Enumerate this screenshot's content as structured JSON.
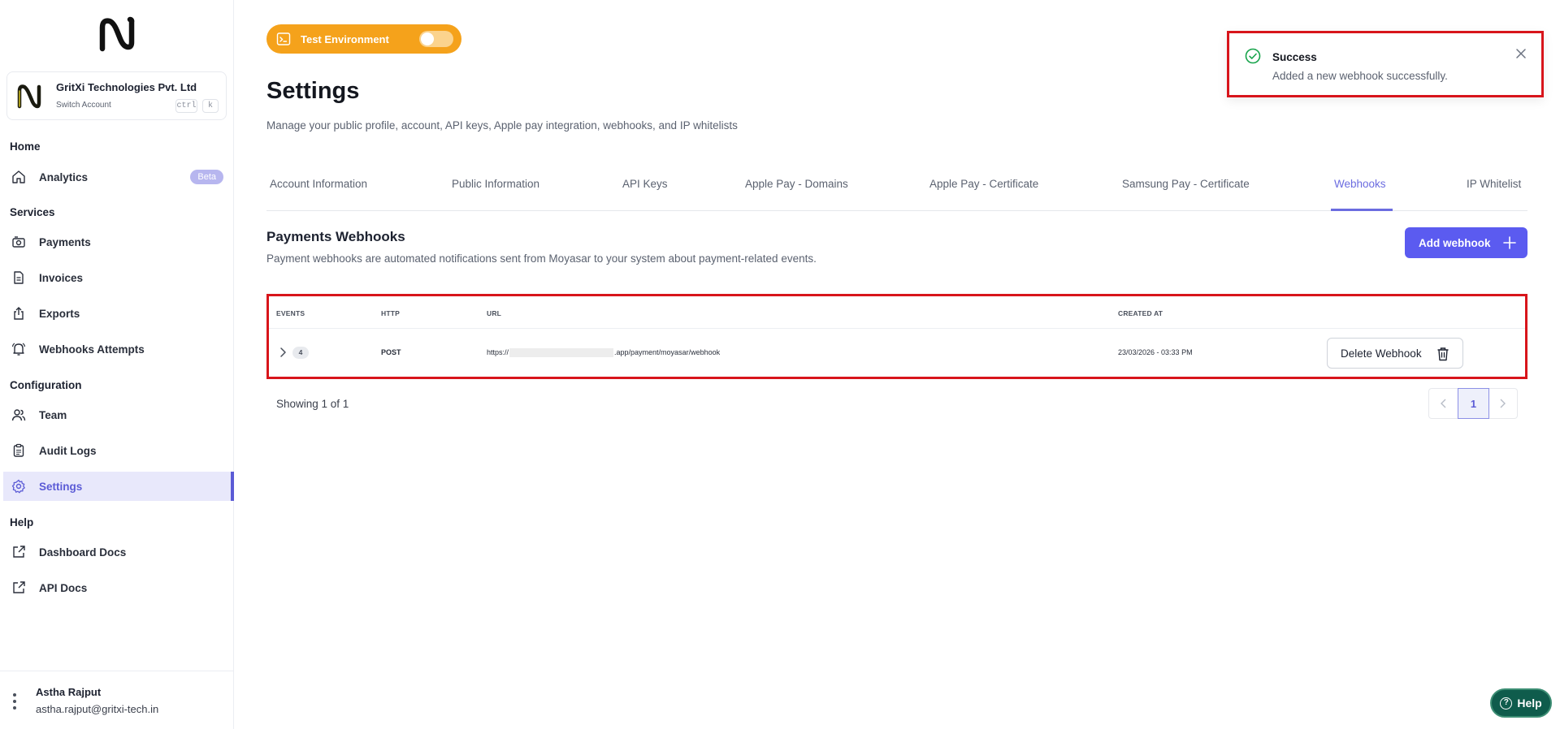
{
  "account": {
    "name": "GritXi Technologies Pvt. Ltd",
    "switch_label": "Switch Account",
    "kbd_ctrl": "ctrl",
    "kbd_k": "k"
  },
  "sidebar": {
    "sections": {
      "home": "Home",
      "services": "Services",
      "configuration": "Configuration",
      "help": "Help"
    },
    "items": {
      "analytics": {
        "label": "Analytics",
        "badge": "Beta",
        "icon": "home-icon"
      },
      "payments": {
        "label": "Payments",
        "icon": "camera-icon"
      },
      "invoices": {
        "label": "Invoices",
        "icon": "document-icon"
      },
      "exports": {
        "label": "Exports",
        "icon": "share-icon"
      },
      "webhooks_attempts": {
        "label": "Webhooks Attempts",
        "icon": "bell-icon"
      },
      "team": {
        "label": "Team",
        "icon": "team-icon"
      },
      "audit_logs": {
        "label": "Audit Logs",
        "icon": "clipboard-icon"
      },
      "settings": {
        "label": "Settings",
        "icon": "gear-icon"
      },
      "dashboard_docs": {
        "label": "Dashboard Docs",
        "icon": "external-link-icon"
      },
      "api_docs": {
        "label": "API Docs",
        "icon": "external-link-icon"
      }
    },
    "active": "settings"
  },
  "user": {
    "name": "Astha Rajput",
    "email": "astha.rajput@gritxi-tech.in"
  },
  "env_toggle": {
    "label": "Test Environment"
  },
  "page": {
    "title": "Settings",
    "subtitle": "Manage your public profile, account, API keys, Apple pay integration, webhooks, and IP whitelists"
  },
  "tabs": [
    {
      "label": "Account Information"
    },
    {
      "label": "Public Information"
    },
    {
      "label": "API Keys"
    },
    {
      "label": "Apple Pay - Domains"
    },
    {
      "label": "Apple Pay - Certificate"
    },
    {
      "label": "Samsung Pay - Certificate"
    },
    {
      "label": "Webhooks"
    },
    {
      "label": "IP Whitelist"
    }
  ],
  "active_tab": "Webhooks",
  "webhooks": {
    "title": "Payments Webhooks",
    "description": "Payment webhooks are automated notifications sent from Moyasar to your system about payment-related events.",
    "add_button": "Add webhook",
    "columns": {
      "events": "EVENTS",
      "http": "HTTP",
      "url": "URL",
      "created_at": "CREATED AT"
    },
    "rows": [
      {
        "events_count": "4",
        "http": "POST",
        "url_prefix": "https://",
        "url_suffix": ".app/payment/moyasar/webhook",
        "created_at": "23/03/2026 - 03:33 PM",
        "delete_label": "Delete Webhook"
      }
    ],
    "showing": "Showing 1 of 1",
    "current_page": "1"
  },
  "toast": {
    "title": "Success",
    "message": "Added a new webhook successfully."
  },
  "help": {
    "label": "Help"
  },
  "colors": {
    "accent": "#5b5bf0",
    "env_orange": "#f5a21b",
    "success": "#16a34a",
    "highlight_red": "#d8151b",
    "help_green": "#0f5c4c"
  }
}
